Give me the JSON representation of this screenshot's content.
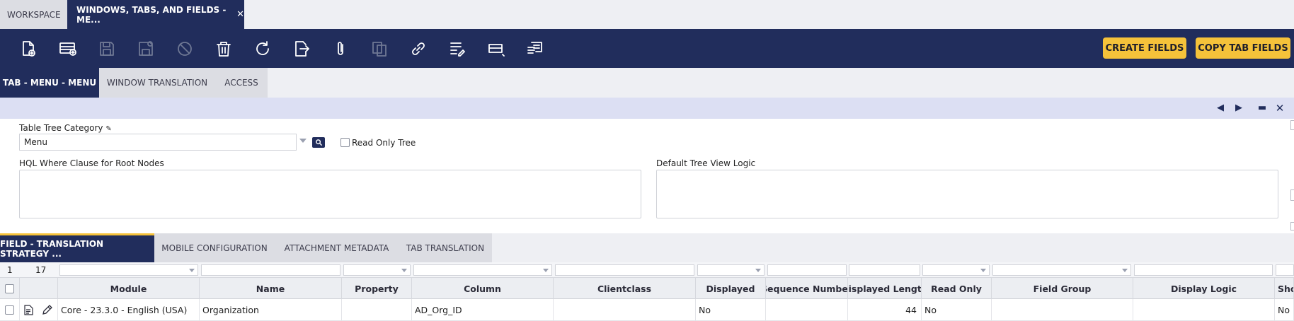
{
  "top_tabs": [
    {
      "label": "Workspace"
    },
    {
      "label": "Windows, Tabs, and Fields - Me..."
    }
  ],
  "toolbar": {
    "icons": [
      "new-document-icon",
      "new-row-icon",
      "save-icon",
      "save-close-icon",
      "undo-icon",
      "delete-icon",
      "refresh-icon",
      "export-icon",
      "attach-icon",
      "clone-icon",
      "link-icon",
      "audit-trail-icon",
      "grid-form-toggle-icon",
      "notes-icon"
    ],
    "create_fields_label": "Create Fields",
    "copy_tab_fields_label": "Copy Tab Fields"
  },
  "sub_tabs": [
    {
      "label": "Tab - Menu - Menu"
    },
    {
      "label": "Window Translation"
    },
    {
      "label": "Access"
    }
  ],
  "form": {
    "table_tree_category_label": "Table Tree Category",
    "table_tree_category_value": "Menu",
    "read_only_tree_label": "Read Only Tree",
    "hql_label": "HQL Where Clause for Root Nodes",
    "default_tree_view_label": "Default Tree View Logic"
  },
  "lower_tabs": [
    {
      "label": "Field - Translation Strategy ..."
    },
    {
      "label": "Mobile Configuration"
    },
    {
      "label": "Attachment Metadata"
    },
    {
      "label": "Tab Translation"
    }
  ],
  "grid": {
    "selected_count": "1",
    "total_count": "17",
    "columns": [
      "Module",
      "Name",
      "Property",
      "Column",
      "Clientclass",
      "Displayed",
      "Sequence Number",
      "Displayed Length",
      "Read Only",
      "Field Group",
      "Display Logic",
      "Sho"
    ],
    "rows": [
      {
        "module": "Core - 23.3.0 - English (USA)",
        "name": "Organization",
        "property": "",
        "column": "AD_Org_ID",
        "clientclass": "",
        "displayed": "No",
        "sequence_number": "",
        "displayed_length": "44",
        "read_only": "No",
        "field_group": "",
        "display_logic": "",
        "sho": "No"
      }
    ]
  },
  "colors": {
    "navy": "#212d5c",
    "accent": "#f5c23a",
    "status_bar": "#dcdff3"
  }
}
